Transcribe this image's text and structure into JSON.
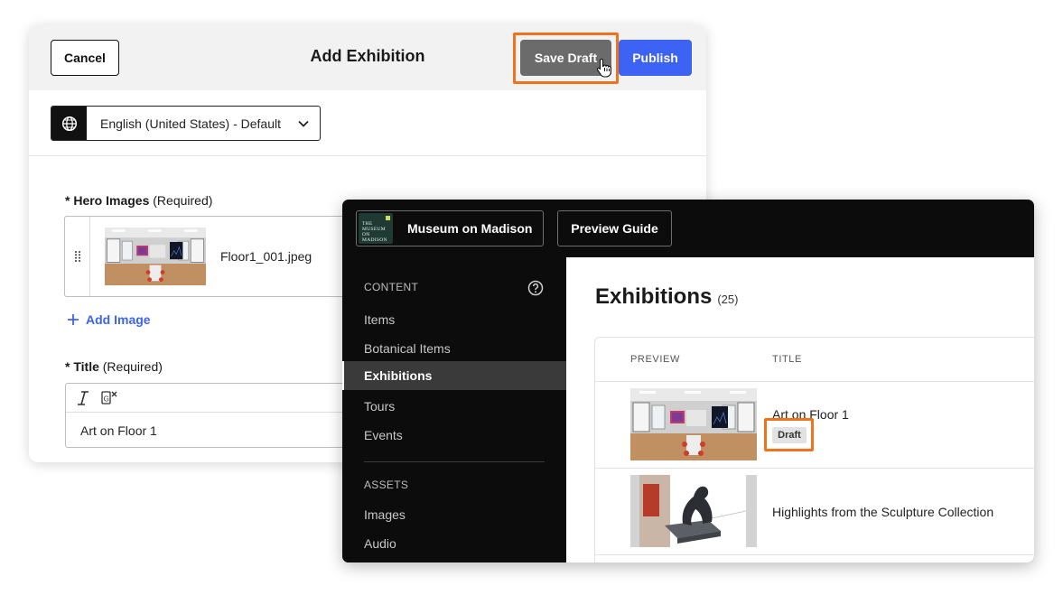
{
  "editor": {
    "cancel_label": "Cancel",
    "title": "Add Exhibition",
    "save_draft_label": "Save Draft",
    "publish_label": "Publish",
    "language_selected": "English (United States) - Default",
    "hero_label_required": "* Hero Images",
    "hero_label_note": "(Required)",
    "hero_filename": "Floor1_001.jpeg",
    "add_image_label": "Add Image",
    "title_label_required": "* Title",
    "title_label_note": "(Required)",
    "title_value": "Art on Floor 1"
  },
  "app": {
    "museum_logo_text": "THE MUSEUM ON MADISON",
    "museum_name": "Museum on Madison",
    "preview_guide_label": "Preview Guide",
    "sidebar": {
      "content_section": "CONTENT",
      "content_items": [
        "Items",
        "Botanical Items",
        "Exhibitions",
        "Tours",
        "Events"
      ],
      "active_item": "Exhibitions",
      "assets_section": "ASSETS",
      "asset_items": [
        "Images",
        "Audio"
      ]
    },
    "main": {
      "title": "Exhibitions",
      "count": "(25)",
      "columns": [
        "PREVIEW",
        "TITLE"
      ],
      "rows": [
        {
          "title": "Art on Floor 1",
          "status": "Draft"
        },
        {
          "title": "Highlights from the Sculpture Collection"
        }
      ]
    }
  },
  "colors": {
    "accent_blue": "#3d63f5",
    "highlight_orange": "#f0731c",
    "save_draft_gray": "#6b6b6b",
    "dark_bg": "#0c0c0c"
  }
}
